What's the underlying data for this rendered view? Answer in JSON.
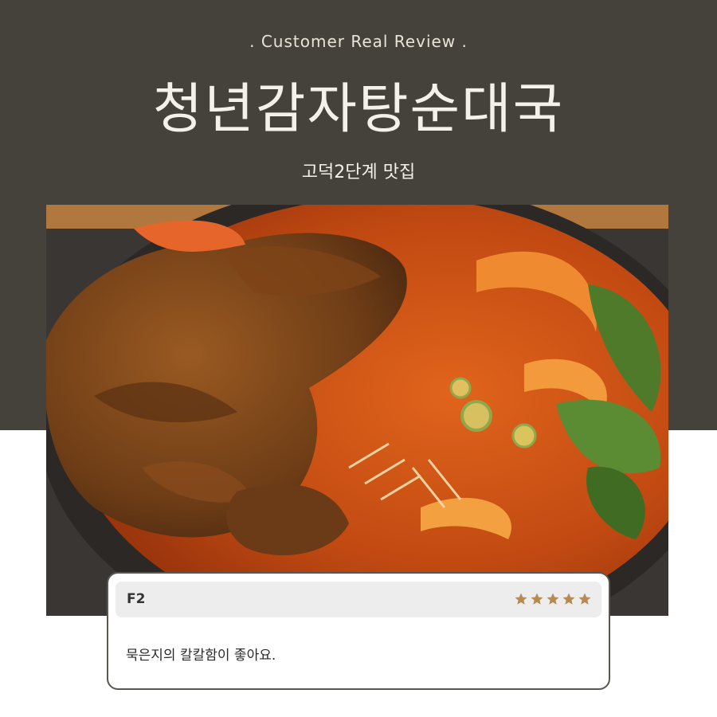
{
  "header": {
    "eyebrow": ". Customer Real Review .",
    "title": "청년감자탕순대국",
    "subtitle": "고덕2단계 맛집"
  },
  "photo": {
    "subject": "gamjatang-stew-photo"
  },
  "review": {
    "reviewer": "F2",
    "rating": 5,
    "rating_max": 5,
    "text": "묵은지의 칼칼함이 좋아요."
  },
  "colors": {
    "band": "#45423b",
    "star": "#b58a53",
    "card_border": "#5a5650",
    "card_header": "#ededed"
  }
}
